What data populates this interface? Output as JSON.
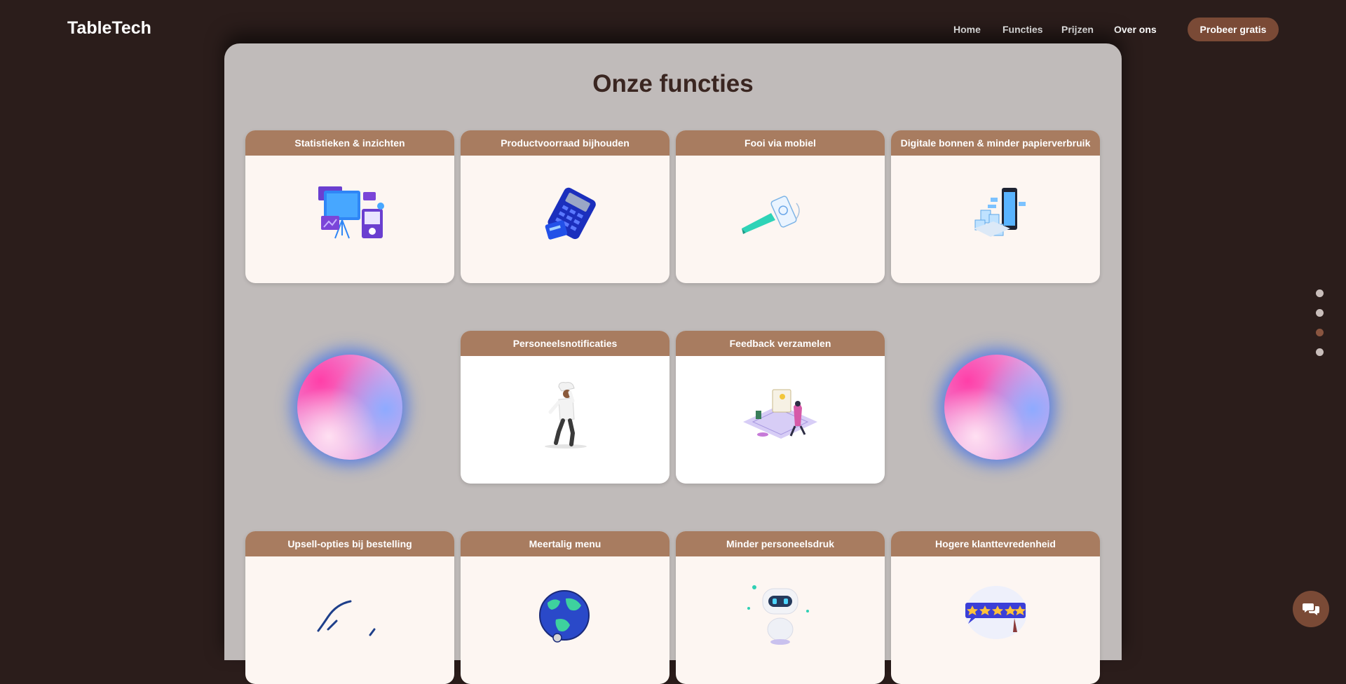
{
  "brand": {
    "logo": "TableTech"
  },
  "nav": {
    "home": "Home",
    "functies": "Functies",
    "prijzen": "Prijzen",
    "over_ons": "Over ons",
    "cta": "Probeer gratis"
  },
  "section": {
    "title": "Onze functies"
  },
  "features": [
    {
      "title": "Statistieken & inzichten",
      "icon": "presentation-board-icon"
    },
    {
      "title": "Productvoorraad bijhouden",
      "icon": "card-terminal-icon"
    },
    {
      "title": "Fooi via mobiel",
      "icon": "mobile-tip-icon"
    },
    {
      "title": "Digitale bonnen & minder papierverbruik",
      "icon": "digital-receipt-icon"
    },
    {
      "title": "Personeelsnotificaties",
      "icon": "chef-illustration-icon"
    },
    {
      "title": "Feedback verzamelen",
      "icon": "feedback-illustration-icon"
    },
    {
      "title": "Upsell-opties bij bestelling",
      "icon": "upsell-curve-icon"
    },
    {
      "title": "Meertalig menu",
      "icon": "globe-icon"
    },
    {
      "title": "Minder personeelsdruk",
      "icon": "robot-icon"
    },
    {
      "title": "Hogere klanttevredenheid",
      "icon": "star-rating-icon"
    }
  ],
  "pager": {
    "count": 4,
    "active_index": 2
  },
  "colors": {
    "background": "#2b1d1b",
    "panel": "#c0bbba",
    "card_header": "#a87c60",
    "accent": "#7a4a36",
    "title": "#3a2621"
  },
  "chat": {
    "icon": "chat-bubbles-icon"
  }
}
